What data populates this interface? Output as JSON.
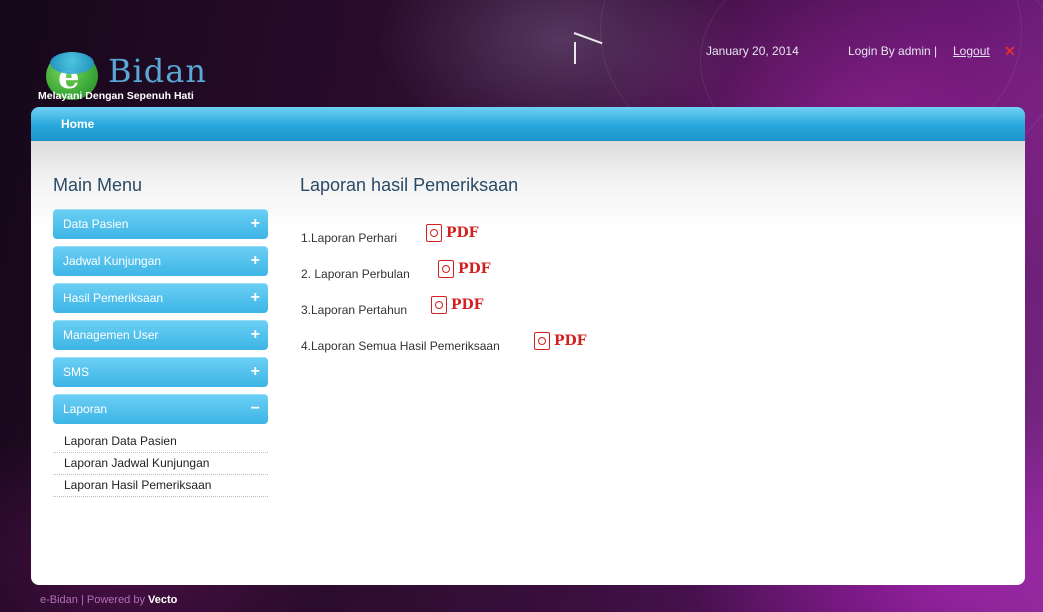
{
  "header": {
    "logo_letter": "e",
    "logo_text": "Bidan",
    "tagline": "Melayani Dengan Sepenuh Hati",
    "date": "January 20, 2014",
    "login_text": "Login By admin |",
    "logout_label": "Logout"
  },
  "nav": {
    "home_label": "Home"
  },
  "sidebar": {
    "title": "Main Menu",
    "items": [
      {
        "label": "Data Pasien",
        "sign": "+"
      },
      {
        "label": "Jadwal Kunjungan",
        "sign": "+"
      },
      {
        "label": "Hasil Pemeriksaan",
        "sign": "+"
      },
      {
        "label": "Managemen User",
        "sign": "+"
      },
      {
        "label": "SMS",
        "sign": "+"
      },
      {
        "label": "Laporan",
        "sign": "−"
      }
    ],
    "sub_items": [
      "Laporan Data Pasien",
      "Laporan Jadwal Kunjungan",
      "Laporan Hasil Pemeriksaan"
    ]
  },
  "main": {
    "title": "Laporan hasil Pemeriksaan",
    "reports": [
      {
        "label": "1.Laporan Perhari",
        "pdf": "PDF"
      },
      {
        "label": "2. Laporan Perbulan",
        "pdf": "PDF"
      },
      {
        "label": "3.Laporan Pertahun",
        "pdf": "PDF"
      },
      {
        "label": "4.Laporan Semua Hasil Pemeriksaan",
        "pdf": "PDF"
      }
    ]
  },
  "footer": {
    "text": "e-Bidan | Powered by",
    "brand": "Vecto"
  },
  "colors": {
    "accent": "#3db5e6",
    "title": "#2b4a66",
    "pdf": "#d02020"
  }
}
